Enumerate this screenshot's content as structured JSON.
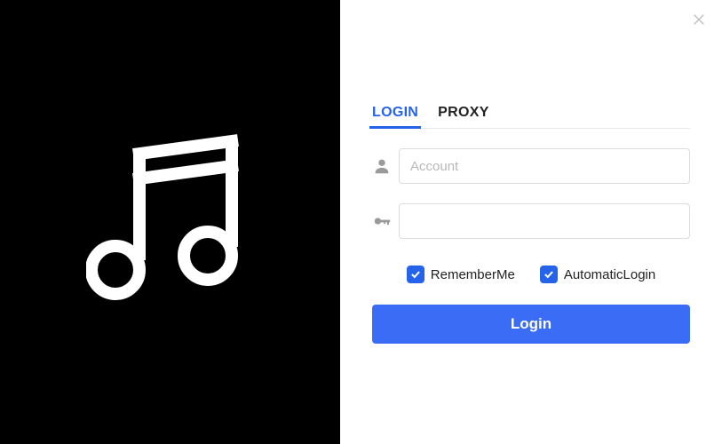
{
  "tabs": {
    "login_label": "LOGIN",
    "proxy_label": "PROXY"
  },
  "fields": {
    "account_placeholder": "Account",
    "account_value": "",
    "password_placeholder": "",
    "password_value": ""
  },
  "checks": {
    "remember_label": "RememberMe",
    "remember_checked": true,
    "auto_label": "AutomaticLogin",
    "auto_checked": true
  },
  "actions": {
    "login_label": "Login"
  },
  "colors": {
    "accent": "#2563eb",
    "button": "#3b6cf5"
  }
}
